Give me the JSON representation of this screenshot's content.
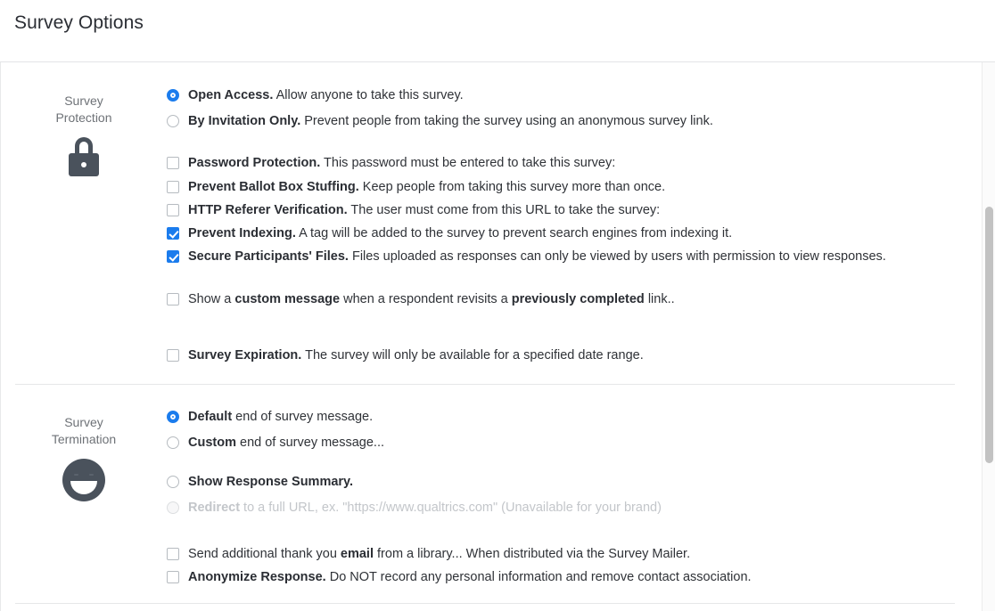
{
  "header": {
    "title": "Survey Options"
  },
  "scrollbar": {
    "name": "vertical-scrollbar"
  },
  "sections": [
    {
      "id": "protection",
      "label": "Survey\nProtection",
      "label_line1": "Survey",
      "label_line2": "Protection",
      "icon": "lock-icon",
      "radios": [
        {
          "name": "open-access",
          "checked": true,
          "bold": "Open Access.",
          "rest": " Allow anyone to take this survey."
        },
        {
          "name": "by-invitation-only",
          "checked": false,
          "bold": "By Invitation Only.",
          "rest": " Prevent people from taking the survey using an anonymous survey link."
        }
      ],
      "checkboxes": [
        {
          "name": "password-protection",
          "checked": false,
          "bold": "Password Protection.",
          "rest": " This password must be entered to take this survey:"
        },
        {
          "name": "prevent-ballot-box-stuffing",
          "checked": false,
          "bold": "Prevent Ballot Box Stuffing.",
          "rest": " Keep people from taking this survey more than once."
        },
        {
          "name": "http-referer-verification",
          "checked": false,
          "bold": "HTTP Referer Verification.",
          "rest": " The user must come from this URL to take the survey:"
        },
        {
          "name": "prevent-indexing",
          "checked": true,
          "bold": "Prevent Indexing.",
          "rest": " A tag will be added to the survey to prevent search engines from indexing it."
        },
        {
          "name": "secure-participants-files",
          "checked": true,
          "bold": "Secure Participants' Files.",
          "rest": " Files uploaded as responses can only be viewed by users with permission to view responses."
        }
      ],
      "custom_message_row": {
        "name": "show-custom-message",
        "checked": false,
        "pre": "Show a ",
        "bold1": "custom message",
        "mid": " when a respondent revisits a ",
        "bold2": "previously completed",
        "post": " link.."
      },
      "expiration_row": {
        "name": "survey-expiration",
        "checked": false,
        "bold": "Survey Expiration.",
        "rest": " The survey will only be available for a specified date range."
      }
    },
    {
      "id": "termination",
      "label_line1": "Survey",
      "label_line2": "Termination",
      "icon": "smiley-icon",
      "radios_group1": [
        {
          "name": "default-end-of-survey-message",
          "checked": true,
          "bold": "Default",
          "rest": " end of survey message."
        },
        {
          "name": "custom-end-of-survey-message",
          "checked": false,
          "bold": "Custom",
          "rest": " end of survey message..."
        }
      ],
      "radios_group2": [
        {
          "name": "show-response-summary",
          "checked": false,
          "disabled": false,
          "bold": "Show Response Summary.",
          "rest": ""
        },
        {
          "name": "redirect-to-full-url",
          "checked": false,
          "disabled": true,
          "bold": "Redirect",
          "rest": " to a full URL, ex. \"https://www.qualtrics.com\" (Unavailable for your brand)"
        }
      ],
      "checkboxes": [
        {
          "name": "send-additional-thank-you-email",
          "checked": false,
          "pre": "Send additional thank you ",
          "bold": "email",
          "post": " from a library... When distributed via the Survey Mailer."
        },
        {
          "name": "anonymize-response",
          "checked": false,
          "bold": "Anonymize Response.",
          "rest": " Do NOT record any personal information and remove contact association."
        }
      ]
    }
  ]
}
